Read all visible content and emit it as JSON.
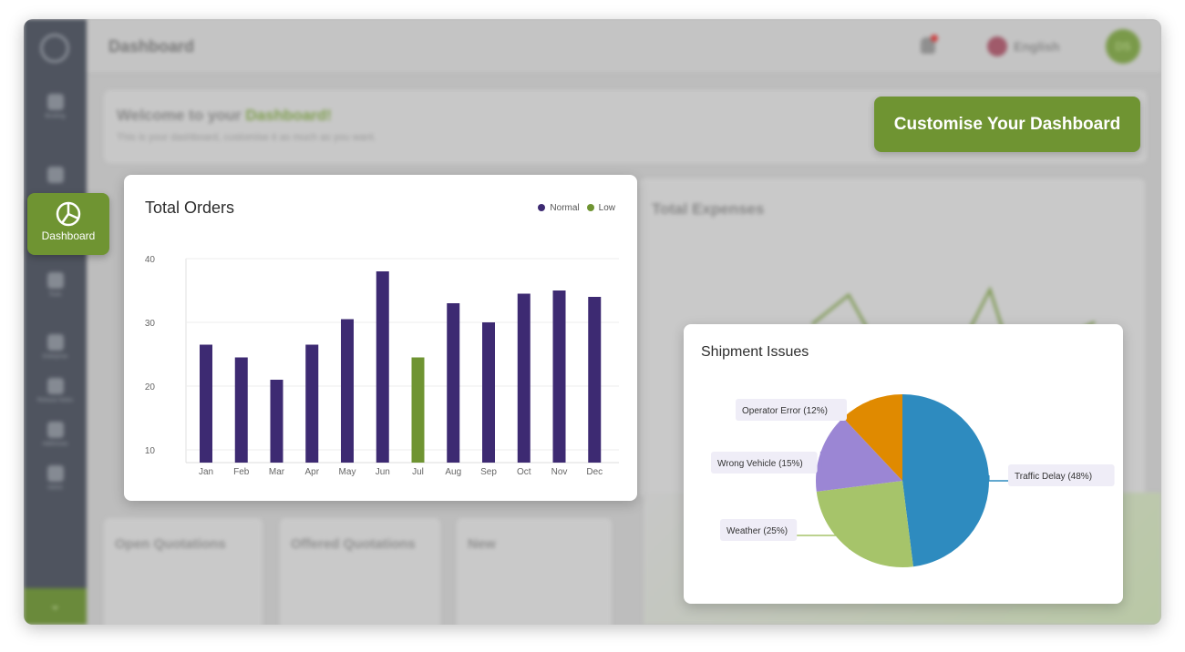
{
  "app": {
    "page_title": "Dashboard"
  },
  "topbar": {
    "language": "English",
    "avatar_initials": "DS"
  },
  "sidebar": {
    "active_label": "Dashboard",
    "items": [
      {
        "label": "Booking"
      },
      {
        "label": "Tools"
      },
      {
        "label": "Enterprise"
      },
      {
        "label": "Release Notes"
      },
      {
        "label": "Addresses"
      },
      {
        "label": "Admin"
      }
    ]
  },
  "welcome": {
    "title_prefix": "Welcome to your ",
    "title_highlight": "Dashboard!",
    "subtitle": "This is your dashboard, customise it as much as you want."
  },
  "customise_button": "Customise Your Dashboard",
  "background_cards": {
    "expenses_title": "Total Expenses",
    "quotations": [
      "Open Quotations",
      "Offered Quotations",
      "New"
    ]
  },
  "colors": {
    "brand_green": "#6f9432",
    "normal_bar": "#3d2a72",
    "low_bar": "#6f9432"
  },
  "orders": {
    "title": "Total Orders",
    "legend": [
      {
        "name": "Normal",
        "color": "#3d2a72"
      },
      {
        "name": "Low",
        "color": "#6f9432"
      }
    ]
  },
  "shipment": {
    "title": "Shipment Issues"
  },
  "chart_data": [
    {
      "type": "bar",
      "title": "Total Orders",
      "categories": [
        "Jan",
        "Feb",
        "Mar",
        "Apr",
        "May",
        "Jun",
        "Jul",
        "Aug",
        "Sep",
        "Oct",
        "Nov",
        "Dec"
      ],
      "values": [
        26.5,
        24.5,
        21,
        26.5,
        30.5,
        38,
        24.5,
        33,
        30,
        34.5,
        35,
        34
      ],
      "status": [
        "Normal",
        "Normal",
        "Normal",
        "Normal",
        "Normal",
        "Normal",
        "Low",
        "Normal",
        "Normal",
        "Normal",
        "Normal",
        "Normal"
      ],
      "series": [
        {
          "name": "Normal"
        },
        {
          "name": "Low"
        }
      ],
      "yticks": [
        10,
        20,
        30,
        40
      ],
      "ylim": [
        8,
        40
      ],
      "grid": true,
      "legend_position": "top-right"
    },
    {
      "type": "pie",
      "title": "Shipment Issues",
      "slices": [
        {
          "label": "Traffic Delay (48%)",
          "value": 48,
          "color": "#2e8bbf"
        },
        {
          "label": "Weather (25%)",
          "value": 25,
          "color": "#a6c46a"
        },
        {
          "label": "Wrong Vehicle (15%)",
          "value": 15,
          "color": "#9b86d4"
        },
        {
          "label": "Operator Error (12%)",
          "value": 12,
          "color": "#e08a00"
        }
      ]
    }
  ]
}
